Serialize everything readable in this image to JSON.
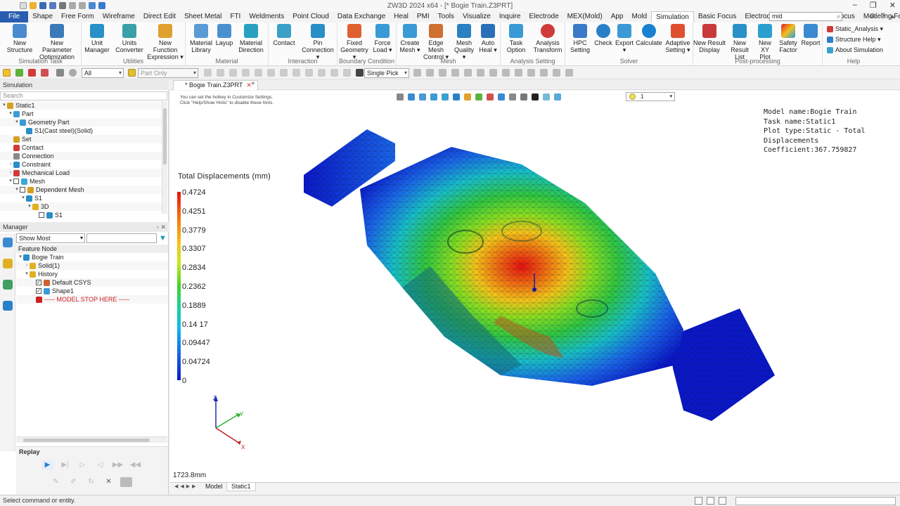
{
  "app": {
    "title": "ZW3D 2024 x64 - [* Bogie Train.Z3PRT]",
    "window_controls": [
      "–",
      "❐",
      "✕"
    ]
  },
  "ribbon_tabs": [
    "File",
    "Shape",
    "Free Form",
    "Wireframe",
    "Direct Edit",
    "Sheet Metal",
    "FTI",
    "Weldments",
    "Point Cloud",
    "Data Exchange",
    "Heal",
    "PMI",
    "Tools",
    "Visualize",
    "Inquire",
    "Electrode",
    "MEX(Mold)",
    "App",
    "Mold",
    "Simulation",
    "Basic Focus",
    "Electrode Focus",
    "Face Edit Focus",
    "Modeling Focus"
  ],
  "ribbon_search": "mid",
  "ribbon": {
    "groups": [
      "Simulation Task",
      "Utilities",
      "Material",
      "Interaction",
      "Boundary Condition",
      "Mesh",
      "Analysis Setting",
      "Solver",
      "Post-processing",
      "Help"
    ],
    "buttons": [
      {
        "l1": "New",
        "l2": "Structure"
      },
      {
        "l1": "New Parameter",
        "l2": "Optimization"
      },
      {
        "l1": "Unit",
        "l2": "Manager"
      },
      {
        "l1": "Units",
        "l2": "Converter"
      },
      {
        "l1": "New Function",
        "l2": "Expression ▾"
      },
      {
        "l1": "Material",
        "l2": "Library"
      },
      {
        "l1": "Layup",
        "l2": ""
      },
      {
        "l1": "Material",
        "l2": "Direction"
      },
      {
        "l1": "Contact",
        "l2": ""
      },
      {
        "l1": "Pin",
        "l2": "Connection ▾"
      },
      {
        "l1": "Fixed",
        "l2": "Geometry ▾"
      },
      {
        "l1": "Force",
        "l2": "Load ▾"
      },
      {
        "l1": "Create",
        "l2": "Mesh ▾"
      },
      {
        "l1": "Edge Mesh",
        "l2": "Control ▾"
      },
      {
        "l1": "Mesh",
        "l2": "Quality ▾"
      },
      {
        "l1": "Auto",
        "l2": "Heal ▾"
      },
      {
        "l1": "Task",
        "l2": "Option"
      },
      {
        "l1": "Analysis",
        "l2": "Transform"
      },
      {
        "l1": "HPC",
        "l2": "Setting"
      },
      {
        "l1": "Check",
        "l2": ""
      },
      {
        "l1": "Export",
        "l2": "▾"
      },
      {
        "l1": "Calculate",
        "l2": ""
      },
      {
        "l1": "Adaptive",
        "l2": "Setting ▾"
      },
      {
        "l1": "New Result",
        "l2": "Display"
      },
      {
        "l1": "New Result",
        "l2": "List"
      },
      {
        "l1": "New XY",
        "l2": "Plot"
      },
      {
        "l1": "Safety",
        "l2": "Factor"
      },
      {
        "l1": "Report",
        "l2": ""
      }
    ],
    "help_items": [
      "Static_Analysis ▾",
      "Structure Help ▾",
      "About Simulation"
    ]
  },
  "toolbar": {
    "filter_value": "All",
    "part_only": "Part Only",
    "pick_mode": "Single Pick"
  },
  "simulation_panel": {
    "header": "Simulation",
    "search_placeholder": "Search",
    "tree": [
      {
        "label": "Static1",
        "indent": 0,
        "tw": "▾",
        "icon": "#d6a020",
        "cb": false
      },
      {
        "label": "Part",
        "indent": 1,
        "tw": "▾",
        "icon": "#3a9ad6",
        "cb": false
      },
      {
        "label": "Geometry Part",
        "indent": 2,
        "tw": "▾",
        "icon": "#3a9ad6",
        "cb": false
      },
      {
        "label": "S1(Cast steel)(Solid)",
        "indent": 3,
        "tw": "",
        "icon": "#2a8ec8",
        "cb": false
      },
      {
        "label": "Set",
        "indent": 1,
        "tw": "",
        "icon": "#d6a020",
        "cb": false
      },
      {
        "label": "Contact",
        "indent": 1,
        "tw": "",
        "icon": "#d03a3a",
        "cb": false
      },
      {
        "label": "Connection",
        "indent": 1,
        "tw": "",
        "icon": "#888888",
        "cb": false
      },
      {
        "label": "Constraint",
        "indent": 1,
        "tw": "›",
        "icon": "#2a8ec8",
        "cb": false
      },
      {
        "label": "Mechanical Load",
        "indent": 1,
        "tw": "›",
        "icon": "#d03a3a",
        "cb": false
      },
      {
        "label": "Mesh",
        "indent": 1,
        "tw": "▾",
        "icon": "#3aa8d6",
        "cb": true
      },
      {
        "label": "Dependent Mesh",
        "indent": 2,
        "tw": "▾",
        "icon": "#d6a020",
        "cb": true
      },
      {
        "label": "S1",
        "indent": 3,
        "tw": "▾",
        "icon": "#2a8ec8",
        "cb": false
      },
      {
        "label": "3D",
        "indent": 4,
        "tw": "▾",
        "icon": "#e0b020",
        "cb": false
      },
      {
        "label": "S1",
        "indent": 5,
        "tw": "",
        "icon": "#2a8ec8",
        "cb": true
      }
    ]
  },
  "manager_panel": {
    "header": "Manager",
    "filter_value": "Show Most",
    "col_header": "Feature Node",
    "tree": [
      {
        "label": "Bogie Train",
        "indent": 0,
        "tw": "▾",
        "icon": "#2a8ec8",
        "cb": false,
        "checked": false
      },
      {
        "label": "Solid(1)",
        "indent": 1,
        "tw": "›",
        "icon": "#e0b020",
        "cb": false,
        "checked": false
      },
      {
        "label": "History",
        "indent": 1,
        "tw": "▾",
        "icon": "#e0b020",
        "cb": false,
        "checked": false
      },
      {
        "label": "Default CSYS",
        "indent": 2,
        "tw": "",
        "icon": "#d06030",
        "cb": true,
        "checked": true
      },
      {
        "label": "Shape1",
        "indent": 2,
        "tw": "",
        "icon": "#3a9ad6",
        "cb": true,
        "checked": true
      },
      {
        "label": "----- MODEL STOP HERE -----",
        "indent": 2,
        "tw": "",
        "icon": "#d02020",
        "cb": false,
        "checked": false,
        "red": true
      }
    ],
    "replay_label": "Replay"
  },
  "document": {
    "tab_label": "* Bogie Train.Z3PRT",
    "hint_line1": "You can set the hotkey in Customize Settings.",
    "hint_line2": "Click \"Help/Show Hints\" to disable these hints.",
    "view_dropdown": "1"
  },
  "result_info": {
    "model_name": "Model name:Bogie Train",
    "task_name": "Task name:Static1",
    "plot_type": "Plot type:Static - Total Displacements",
    "coefficient": "Coefficient:367.759827"
  },
  "legend": {
    "title": "Total Displacements (mm)",
    "values": [
      "0.4724",
      "0.4251",
      "0.3779",
      "0.3307",
      "0.2834",
      "0.2362",
      "0.1889",
      "0.14 17",
      "0.09447",
      "0.04724",
      "0"
    ]
  },
  "triad": {
    "z": "Z",
    "y": "Y",
    "x": "X"
  },
  "scale_label": "1723.8mm",
  "bottom_tabs": [
    "Model",
    "Static1"
  ],
  "status": {
    "text": "Select command or entity."
  },
  "colors": {
    "file_tab": "#2a5db0",
    "accent": "#2a5db0",
    "max_disp": "#e81010",
    "min_disp": "#0a18c8"
  }
}
